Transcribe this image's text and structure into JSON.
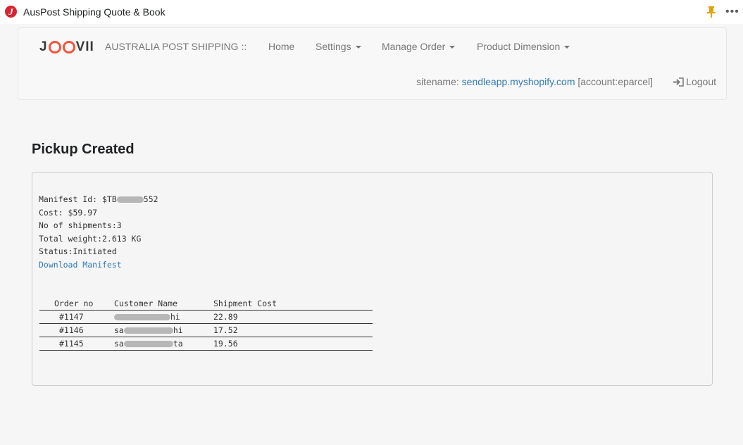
{
  "window": {
    "title": "AusPost Shipping Quote & Book",
    "app_icon_letter": "J",
    "icons": [
      "pin-icon",
      "more-icon"
    ],
    "more_label": "•••"
  },
  "navbar": {
    "brand": "JOOVII",
    "label": "AUSTRALIA POST SHIPPING ::",
    "items": [
      {
        "label": "Home",
        "dropdown": false
      },
      {
        "label": "Settings",
        "dropdown": true
      },
      {
        "label": "Manage Order",
        "dropdown": true
      },
      {
        "label": "Product Dimension",
        "dropdown": true
      }
    ],
    "sitename_prefix": "sitename:",
    "sitename": "sendleapp.myshopify.com",
    "account": "[account:eparcel]",
    "logout": "Logout"
  },
  "main": {
    "title": "Pickup Created",
    "manifest_label": "Manifest Id: $TB",
    "manifest_tail": "552",
    "cost": "Cost: $59.97",
    "shipments": "No of shipments:3",
    "weight": "Total weight:2.613 KG",
    "status": "Status:Initiated",
    "download": "Download Manifest",
    "table": {
      "headers": [
        "Order no",
        "Customer Name",
        "Shipment Cost"
      ],
      "rows": [
        {
          "order": "#1147",
          "name_start": "",
          "name_end": "hi",
          "cost": "22.89"
        },
        {
          "order": "#1146",
          "name_start": "sa",
          "name_end": "hi",
          "cost": "17.52"
        },
        {
          "order": "#1145",
          "name_start": "sa",
          "name_end": "ta",
          "cost": "19.56"
        }
      ]
    }
  },
  "colors": {
    "brand_o": "#f2543d",
    "link": "#337ab7",
    "app_icon": "#d9232e",
    "pin": "#e5a100"
  }
}
